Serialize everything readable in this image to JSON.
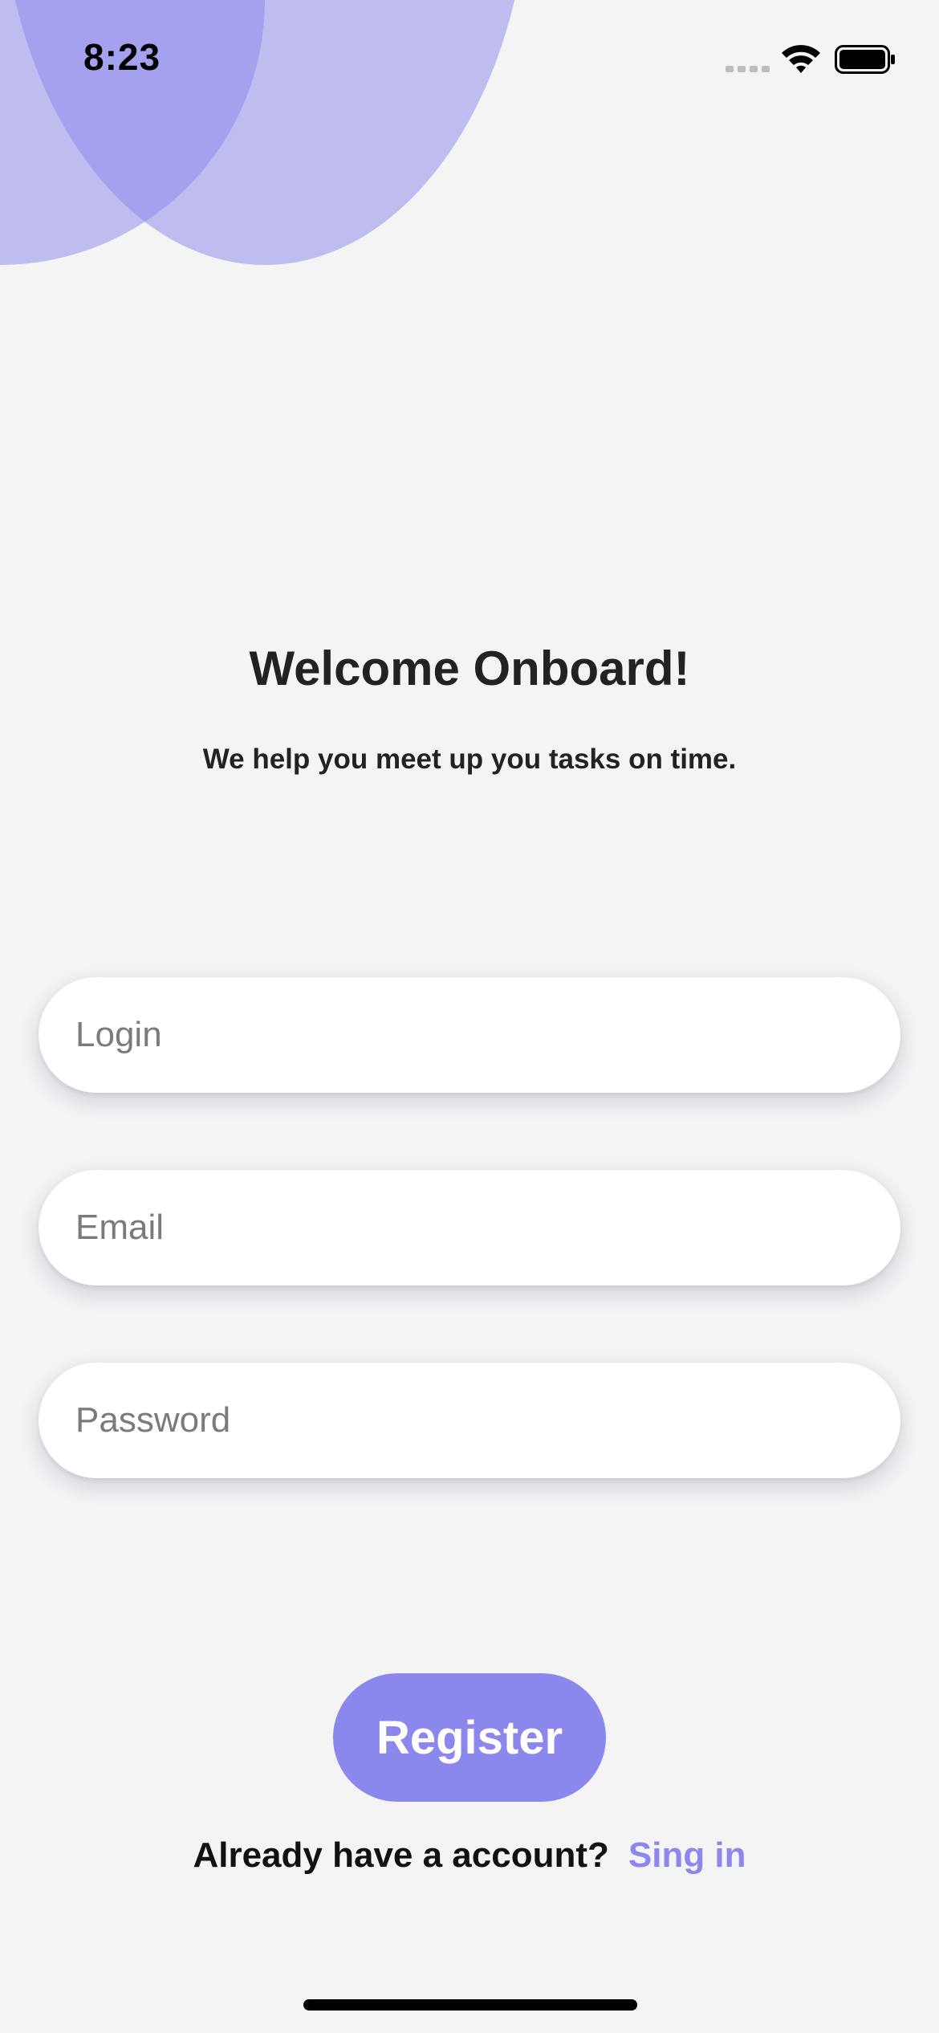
{
  "status_bar": {
    "time": "8:23",
    "icons": [
      "signal-icon",
      "wifi-icon",
      "battery-icon"
    ]
  },
  "header": {
    "title": "Welcome Onboard!",
    "subtitle": "We help you meet up you tasks on time."
  },
  "form": {
    "login": {
      "placeholder": "Login",
      "value": ""
    },
    "email": {
      "placeholder": "Email",
      "value": ""
    },
    "password": {
      "placeholder": "Password",
      "value": ""
    }
  },
  "actions": {
    "register_label": "Register",
    "signin_prompt": "Already have a account?",
    "signin_label": "Sing in"
  },
  "colors": {
    "accent": "#8b87ec",
    "background": "#f4f4f5",
    "decor_circle": "#c0bcf3"
  }
}
